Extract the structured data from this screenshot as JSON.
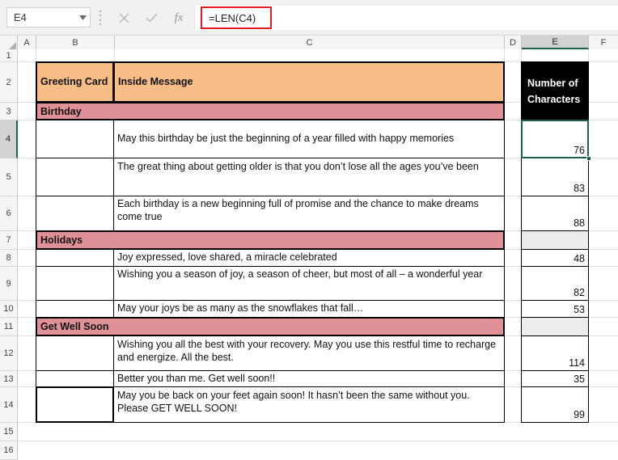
{
  "formula_bar": {
    "name_box_value": "E4",
    "name_box_icon": "chevron-down-icon",
    "cancel_icon": "close-icon",
    "enter_icon": "check-icon",
    "function_icon": "fx-icon",
    "formula_value": "=LEN(C4)",
    "highlight_color": "#e01b22"
  },
  "grid": {
    "column_headers": [
      "A",
      "B",
      "C",
      "D",
      "E",
      "F"
    ],
    "selected_column": "E",
    "row_headers": [
      "1",
      "2",
      "3",
      "4",
      "5",
      "6",
      "7",
      "8",
      "9",
      "10",
      "11",
      "12",
      "13",
      "14",
      "15",
      "16"
    ],
    "selected_row": "4",
    "selected_cell": "E4"
  },
  "table": {
    "header": {
      "greeting_card": "Greeting Card",
      "inside_message": "Inside Message",
      "number_of_characters": "Number of Characters",
      "header_fill": "#f6bd87",
      "counter_header_fill": "#000000",
      "section_fill": "#df9197"
    },
    "sections": [
      {
        "title": "Birthday",
        "rows": [
          {
            "message": "May this birthday be just the beginning of a year filled with happy memories",
            "count": "76"
          },
          {
            "message": "The great thing about getting older is that you don’t lose all the ages you’ve been",
            "count": "83"
          },
          {
            "message": "Each birthday is a new beginning full of promise and the chance to make dreams come true",
            "count": "88"
          }
        ]
      },
      {
        "title": "Holidays",
        "rows": [
          {
            "message": "Joy expressed, love shared, a miracle celebrated",
            "count": "48"
          },
          {
            "message": "Wishing you a season of joy, a season of cheer, but most of all – a wonderful year",
            "count": "82"
          },
          {
            "message": "May your joys be as many as the snowflakes that fall…",
            "count": "53"
          }
        ]
      },
      {
        "title": "Get Well Soon",
        "rows": [
          {
            "message": "Wishing you all the best with your recovery. May you use this restful time to recharge and energize. All the best.",
            "count": "114"
          },
          {
            "message": "Better you than me. Get well soon!!",
            "count": "35"
          },
          {
            "message": "May you be back on your feet again soon! It hasn’t been the same without you. Please GET WELL SOON!",
            "count": "99"
          }
        ]
      }
    ]
  }
}
